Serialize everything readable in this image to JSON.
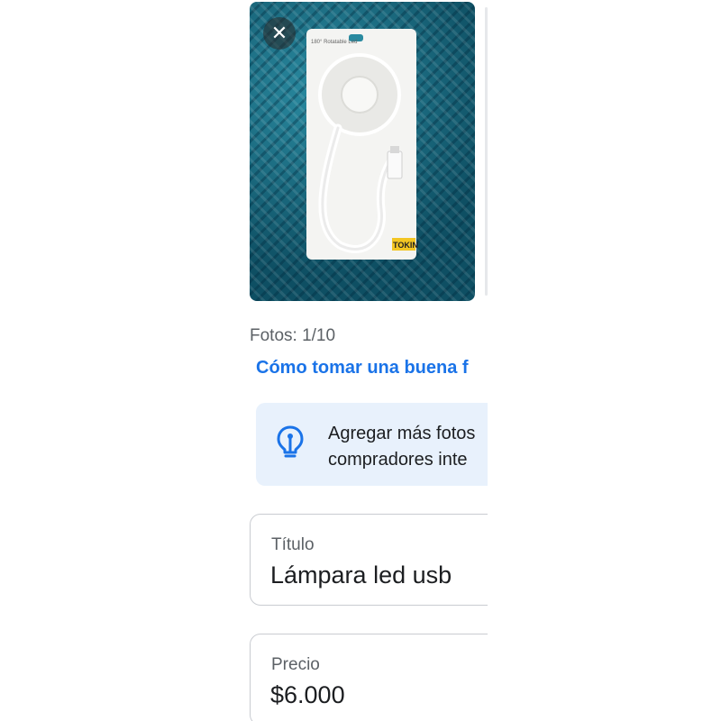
{
  "photo": {
    "close_icon": "close-icon",
    "package_top_text": "180° Rotatable Led",
    "package_brand": "TOKIN"
  },
  "photo_counter": "Fotos: 1/10",
  "tips_link": "Cómo tomar una buena f",
  "tip": {
    "icon": "lightbulb-icon",
    "line1": "Agregar más fotos",
    "line2": "compradores inte"
  },
  "title_field": {
    "label": "Título",
    "value": "Lámpara led usb"
  },
  "price_field": {
    "label": "Precio",
    "value": "$6.000"
  },
  "colors": {
    "accent": "#1a73e8",
    "tip_background": "#e8f1fc",
    "field_border": "#c9ccd1"
  }
}
